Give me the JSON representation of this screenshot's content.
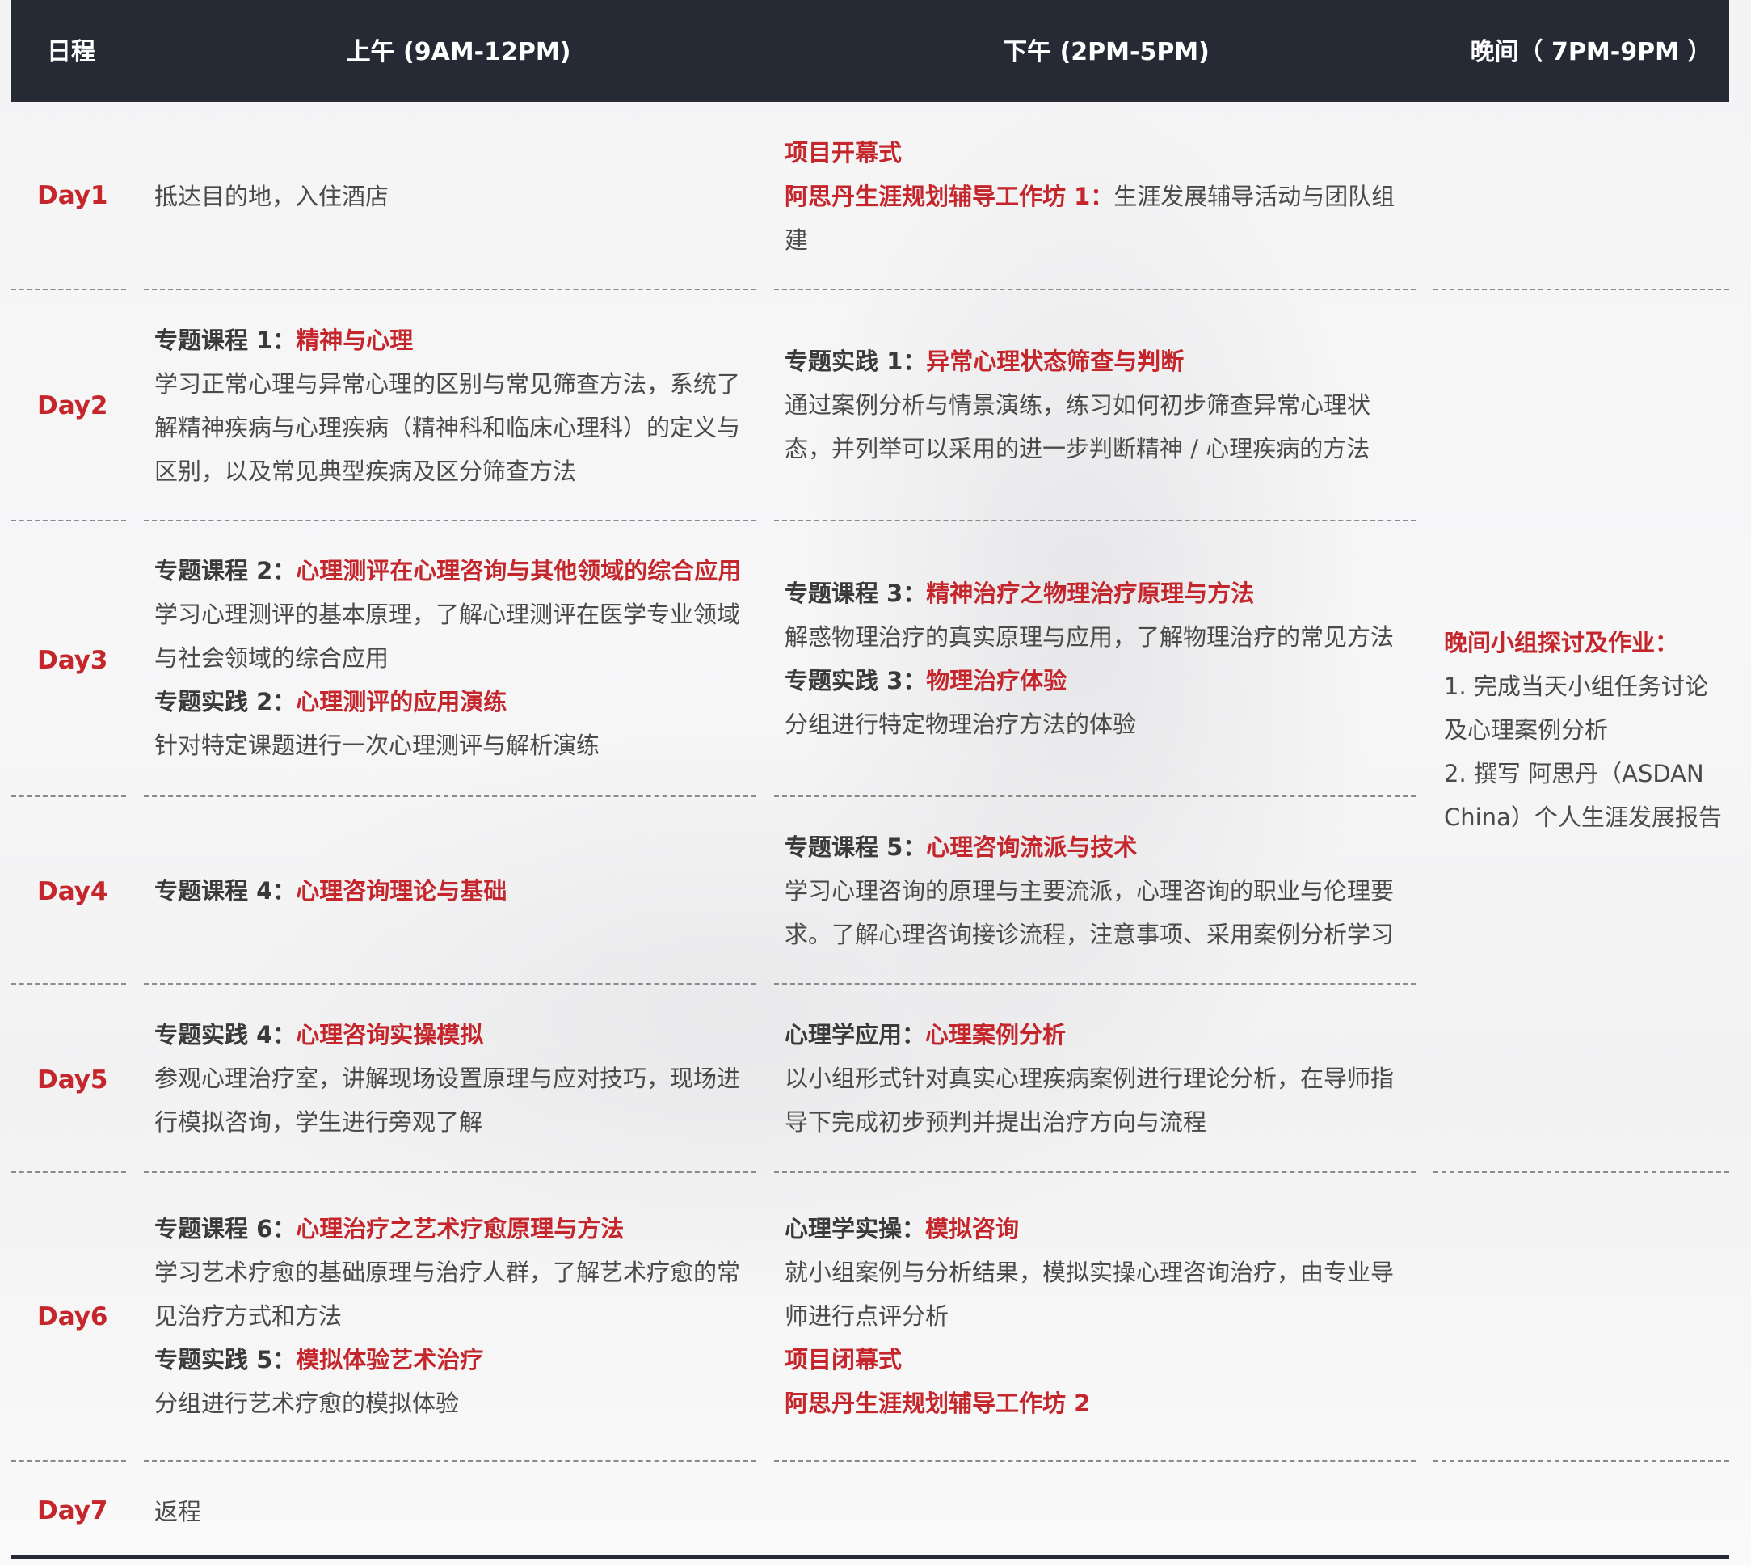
{
  "header": {
    "col_day": "日程",
    "col_am": "上午 (9AM-12PM)",
    "col_pm": "下午 (2PM-5PM)",
    "col_eve": "晚间（ 7PM-9PM ）"
  },
  "days": [
    {
      "label": "Day1",
      "am": {
        "text": "抵达目的地，入住酒店"
      },
      "pm": {
        "title_red": "项目开幕式",
        "workshop_red": "阿思丹生涯规划辅导工作坊 1：",
        "workshop_text": "生涯发展辅导活动与团队组建"
      }
    },
    {
      "label": "Day2",
      "am": {
        "label": "专题课程 1：",
        "title": "精神与心理",
        "text": "学习正常心理与异常心理的区别与常见筛查方法，系统了解精神疾病与心理疾病（精神科和临床心理科）的定义与区别，以及常见典型疾病及区分筛查方法"
      },
      "pm": {
        "label": "专题实践 1：",
        "title": "异常心理状态筛查与判断",
        "text": "通过案例分析与情景演练，练习如何初步筛查异常心理状态，并列举可以采用的进一步判断精神 / 心理疾病的方法"
      }
    },
    {
      "label": "Day3",
      "am": {
        "label": "专题课程 2：",
        "title": "心理测评在心理咨询与其他领域的综合应用",
        "text": "学习心理测评的基本原理，了解心理测评在医学专业领域与社会领域的综合应用",
        "label2": "专题实践 2：",
        "title2": "心理测评的应用演练",
        "text2": "针对特定课题进行一次心理测评与解析演练"
      },
      "pm": {
        "label": "专题课程 3：",
        "title": "精神治疗之物理治疗原理与方法",
        "text": "解惑物理治疗的真实原理与应用，了解物理治疗的常见方法",
        "label2": "专题实践 3：",
        "title2": "物理治疗体验",
        "text2": "分组进行特定物理治疗方法的体验"
      }
    },
    {
      "label": "Day4",
      "am": {
        "label": "专题课程 4：",
        "title": "心理咨询理论与基础"
      },
      "pm": {
        "label": "专题课程 5：",
        "title": "心理咨询流派与技术",
        "text": "学习心理咨询的原理与主要流派，心理咨询的职业与伦理要求。了解心理咨询接诊流程，注意事项、采用案例分析学习"
      }
    },
    {
      "label": "Day5",
      "am": {
        "label": "专题实践 4：",
        "title": "心理咨询实操模拟",
        "text": "参观心理治疗室，讲解现场设置原理与应对技巧，现场进行模拟咨询，学生进行旁观了解"
      },
      "pm": {
        "label": "心理学应用：",
        "title": "心理案例分析",
        "text": "以小组形式针对真实心理疾病案例进行理论分析，在导师指导下完成初步预判并提出治疗方向与流程"
      }
    },
    {
      "label": "Day6",
      "am": {
        "label": "专题课程 6：",
        "title": "心理治疗之艺术疗愈原理与方法",
        "text": "学习艺术疗愈的基础原理与治疗人群，了解艺术疗愈的常见治疗方式和方法",
        "label2": "专题实践 5：",
        "title2": "模拟体验艺术治疗",
        "text2": "分组进行艺术疗愈的模拟体验"
      },
      "pm": {
        "label": "心理学实操：",
        "title": "模拟咨询",
        "text": "就小组案例与分析结果，模拟实操心理咨询治疗，由专业导师进行点评分析",
        "closing_red": "项目闭幕式",
        "workshop_red": "阿思丹生涯规划辅导工作坊 2"
      }
    },
    {
      "label": "Day7",
      "am": {
        "text": "返程"
      }
    }
  ],
  "evening": {
    "title": "晚间小组探讨及作业：",
    "item1": "1. 完成当天小组任务讨论及心理案例分析",
    "item2": "2. 撰写 阿思丹（ASDAN China）个人生涯发展报告"
  },
  "colors": {
    "accent": "#c4262c",
    "header_bg": "#262a35"
  }
}
